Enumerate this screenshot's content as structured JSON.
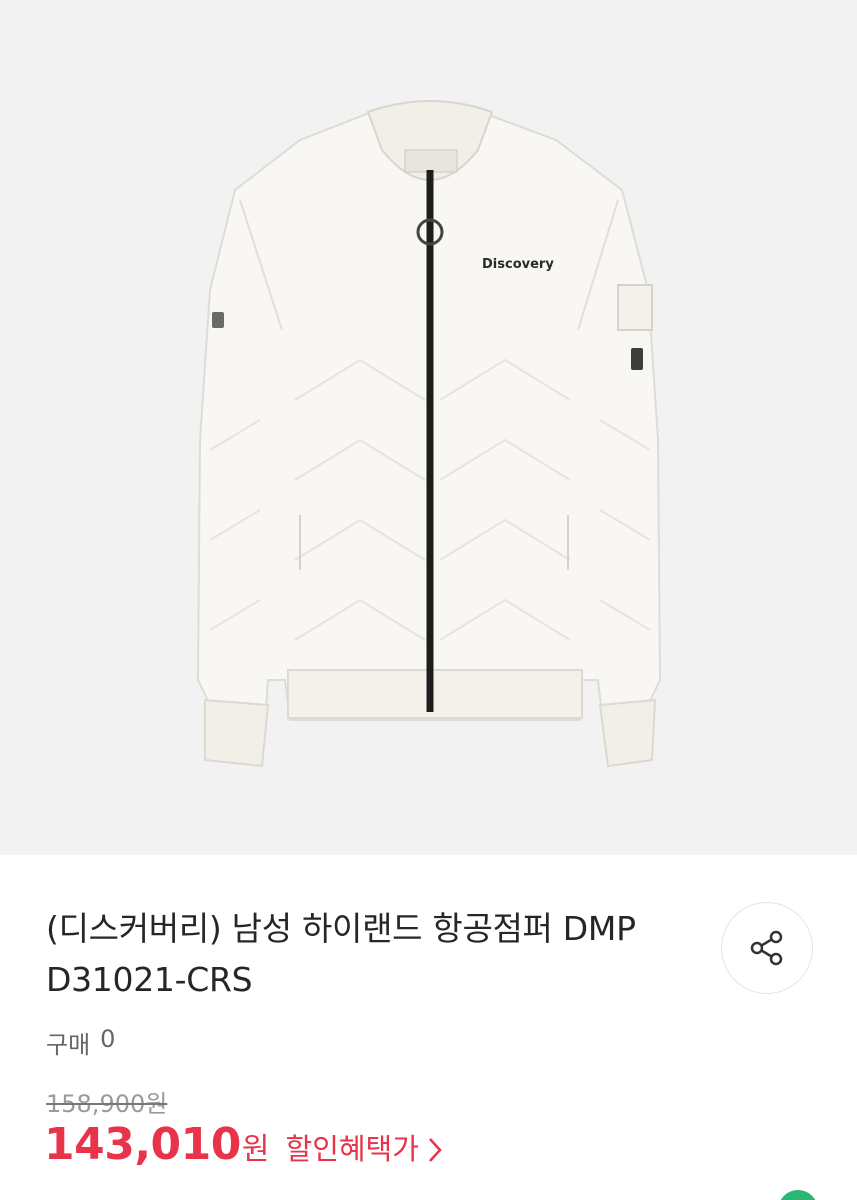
{
  "product": {
    "image_alt_icon": "white-bomber-jacket",
    "brand_mark_text": "Discovery",
    "title": "(디스커버리) 남성 하이랜드 항공점퍼 DMP D31021-CRS",
    "purchase_label": "구매",
    "purchase_count": "0",
    "original_price": "158,900원",
    "sale_price": "143,010",
    "sale_currency": "원",
    "discount_link_label": "할인혜택가"
  },
  "actions": {
    "share_icon": "share-icon",
    "discount_chevron_icon": "chevron-right-icon"
  },
  "colors": {
    "accent_red": "#e8334a",
    "hero_bg": "#f2f2f2",
    "jacket": "#f7f6f2",
    "zipper": "#1d1d1d"
  }
}
